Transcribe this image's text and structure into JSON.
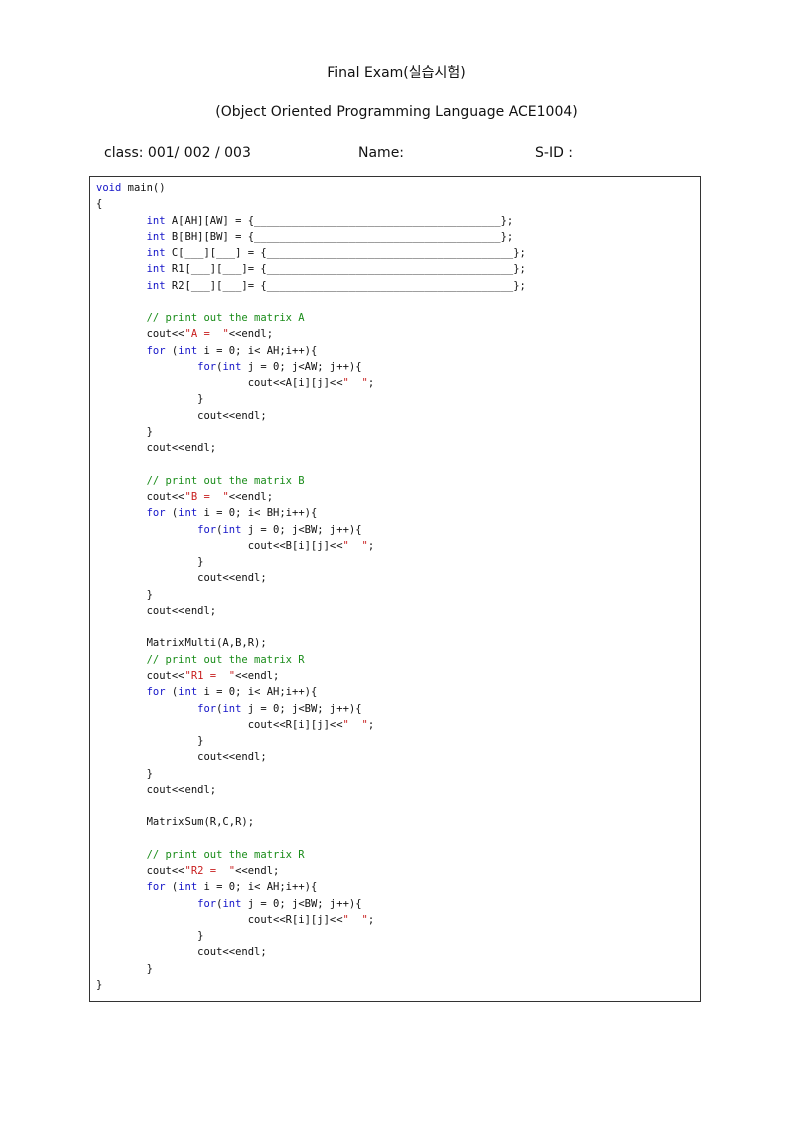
{
  "header": {
    "title": "Final  Exam(실습시험)",
    "subtitle": "(Object  Oriented  Programming  Language  ACE1004)",
    "class_label": "class: 001/ 002 / 003",
    "name_label": "Name:",
    "sid_label": "S-ID :"
  },
  "code_lines": [
    [
      {
        "t": "void",
        "c": "kw"
      },
      {
        "t": " main()",
        "c": ""
      }
    ],
    [
      {
        "t": "{",
        "c": ""
      }
    ],
    [
      {
        "t": "        ",
        "c": ""
      },
      {
        "t": "int",
        "c": "kw"
      },
      {
        "t": " A[AH][AW] = {_______________________________________};",
        "c": ""
      }
    ],
    [
      {
        "t": "        ",
        "c": ""
      },
      {
        "t": "int",
        "c": "kw"
      },
      {
        "t": " B[BH][BW] = {_______________________________________};",
        "c": ""
      }
    ],
    [
      {
        "t": "        ",
        "c": ""
      },
      {
        "t": "int",
        "c": "kw"
      },
      {
        "t": " C[___][___] = {_______________________________________};",
        "c": ""
      }
    ],
    [
      {
        "t": "        ",
        "c": ""
      },
      {
        "t": "int",
        "c": "kw"
      },
      {
        "t": " R1[___][___]= {_______________________________________};",
        "c": ""
      }
    ],
    [
      {
        "t": "        ",
        "c": ""
      },
      {
        "t": "int",
        "c": "kw"
      },
      {
        "t": " R2[___][___]= {_______________________________________};",
        "c": ""
      }
    ],
    [],
    [
      {
        "t": "        ",
        "c": ""
      },
      {
        "t": "// print out the matrix A",
        "c": "cm"
      }
    ],
    [
      {
        "t": "        cout<<",
        "c": ""
      },
      {
        "t": "\"A =  \"",
        "c": "st"
      },
      {
        "t": "<<endl;",
        "c": ""
      }
    ],
    [
      {
        "t": "        ",
        "c": ""
      },
      {
        "t": "for",
        "c": "kw"
      },
      {
        "t": " (",
        "c": ""
      },
      {
        "t": "int",
        "c": "kw"
      },
      {
        "t": " i = 0; i< AH;i++){",
        "c": ""
      }
    ],
    [
      {
        "t": "                ",
        "c": ""
      },
      {
        "t": "for",
        "c": "kw"
      },
      {
        "t": "(",
        "c": ""
      },
      {
        "t": "int",
        "c": "kw"
      },
      {
        "t": " j = 0; j<AW; j++){",
        "c": ""
      }
    ],
    [
      {
        "t": "                        cout<<A[i][j]<<",
        "c": ""
      },
      {
        "t": "\"  \"",
        "c": "st"
      },
      {
        "t": ";",
        "c": ""
      }
    ],
    [
      {
        "t": "                }",
        "c": ""
      }
    ],
    [
      {
        "t": "                cout<<endl;",
        "c": ""
      }
    ],
    [
      {
        "t": "        }",
        "c": ""
      }
    ],
    [
      {
        "t": "        cout<<endl;",
        "c": ""
      }
    ],
    [],
    [
      {
        "t": "        ",
        "c": ""
      },
      {
        "t": "// print out the matrix B",
        "c": "cm"
      }
    ],
    [
      {
        "t": "        cout<<",
        "c": ""
      },
      {
        "t": "\"B =  \"",
        "c": "st"
      },
      {
        "t": "<<endl;",
        "c": ""
      }
    ],
    [
      {
        "t": "        ",
        "c": ""
      },
      {
        "t": "for",
        "c": "kw"
      },
      {
        "t": " (",
        "c": ""
      },
      {
        "t": "int",
        "c": "kw"
      },
      {
        "t": " i = 0; i< BH;i++){",
        "c": ""
      }
    ],
    [
      {
        "t": "                ",
        "c": ""
      },
      {
        "t": "for",
        "c": "kw"
      },
      {
        "t": "(",
        "c": ""
      },
      {
        "t": "int",
        "c": "kw"
      },
      {
        "t": " j = 0; j<BW; j++){",
        "c": ""
      }
    ],
    [
      {
        "t": "                        cout<<B[i][j]<<",
        "c": ""
      },
      {
        "t": "\"  \"",
        "c": "st"
      },
      {
        "t": ";",
        "c": ""
      }
    ],
    [
      {
        "t": "                }",
        "c": ""
      }
    ],
    [
      {
        "t": "                cout<<endl;",
        "c": ""
      }
    ],
    [
      {
        "t": "        }",
        "c": ""
      }
    ],
    [
      {
        "t": "        cout<<endl;",
        "c": ""
      }
    ],
    [],
    [
      {
        "t": "        MatrixMulti(A,B,R);",
        "c": ""
      }
    ],
    [
      {
        "t": "        ",
        "c": ""
      },
      {
        "t": "// print out the matrix R",
        "c": "cm"
      }
    ],
    [
      {
        "t": "        cout<<",
        "c": ""
      },
      {
        "t": "\"R1 =  \"",
        "c": "st"
      },
      {
        "t": "<<endl;",
        "c": ""
      }
    ],
    [
      {
        "t": "        ",
        "c": ""
      },
      {
        "t": "for",
        "c": "kw"
      },
      {
        "t": " (",
        "c": ""
      },
      {
        "t": "int",
        "c": "kw"
      },
      {
        "t": " i = 0; i< AH;i++){",
        "c": ""
      }
    ],
    [
      {
        "t": "                ",
        "c": ""
      },
      {
        "t": "for",
        "c": "kw"
      },
      {
        "t": "(",
        "c": ""
      },
      {
        "t": "int",
        "c": "kw"
      },
      {
        "t": " j = 0; j<BW; j++){",
        "c": ""
      }
    ],
    [
      {
        "t": "                        cout<<R[i][j]<<",
        "c": ""
      },
      {
        "t": "\"  \"",
        "c": "st"
      },
      {
        "t": ";",
        "c": ""
      }
    ],
    [
      {
        "t": "                }",
        "c": ""
      }
    ],
    [
      {
        "t": "                cout<<endl;",
        "c": ""
      }
    ],
    [
      {
        "t": "        }",
        "c": ""
      }
    ],
    [
      {
        "t": "        cout<<endl;",
        "c": ""
      }
    ],
    [],
    [
      {
        "t": "        MatrixSum(R,C,R);",
        "c": ""
      }
    ],
    [],
    [
      {
        "t": "        ",
        "c": ""
      },
      {
        "t": "// print out the matrix R",
        "c": "cm"
      }
    ],
    [
      {
        "t": "        cout<<",
        "c": ""
      },
      {
        "t": "\"R2 =  \"",
        "c": "st"
      },
      {
        "t": "<<endl;",
        "c": ""
      }
    ],
    [
      {
        "t": "        ",
        "c": ""
      },
      {
        "t": "for",
        "c": "kw"
      },
      {
        "t": " (",
        "c": ""
      },
      {
        "t": "int",
        "c": "kw"
      },
      {
        "t": " i = 0; i< AH;i++){",
        "c": ""
      }
    ],
    [
      {
        "t": "                ",
        "c": ""
      },
      {
        "t": "for",
        "c": "kw"
      },
      {
        "t": "(",
        "c": ""
      },
      {
        "t": "int",
        "c": "kw"
      },
      {
        "t": " j = 0; j<BW; j++){",
        "c": ""
      }
    ],
    [
      {
        "t": "                        cout<<R[i][j]<<",
        "c": ""
      },
      {
        "t": "\"  \"",
        "c": "st"
      },
      {
        "t": ";",
        "c": ""
      }
    ],
    [
      {
        "t": "                }",
        "c": ""
      }
    ],
    [
      {
        "t": "                cout<<endl;",
        "c": ""
      }
    ],
    [
      {
        "t": "        }",
        "c": ""
      }
    ],
    [
      {
        "t": "}",
        "c": ""
      }
    ]
  ],
  "colors": {
    "keyword": "#1515c8",
    "comment": "#198c19",
    "string": "#c81e1e",
    "text": "#111111",
    "border": "#333333"
  }
}
